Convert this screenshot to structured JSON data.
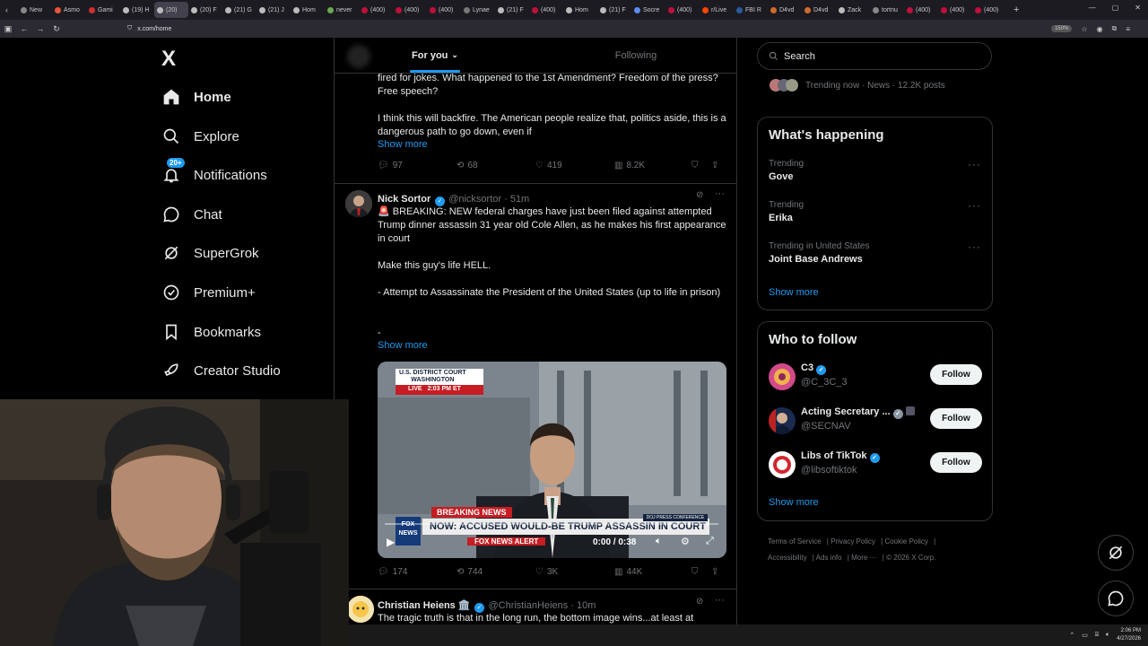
{
  "browser": {
    "tabs": [
      "New",
      "Asmo",
      "Gami",
      "(19) H",
      "(20)",
      "(20) F",
      "(21) G",
      "(21) J",
      "Hom",
      "never",
      "(400)",
      "(400)",
      "(400)",
      "Lynae",
      "(21) F",
      "(400)",
      "Hom",
      "(21) F",
      "Socre",
      "(400)",
      "r/Live",
      "FBI R",
      "D4vd",
      "D4vd",
      "Zack",
      "tortnu",
      "(400)",
      "(400)",
      "(400)"
    ],
    "url": "x.com/home",
    "zoom": "150%"
  },
  "sidebar": {
    "logo": "X",
    "notifications_badge": "20+",
    "items": [
      {
        "label": "Home",
        "icon": "home-icon"
      },
      {
        "label": "Explore",
        "icon": "search-icon"
      },
      {
        "label": "Notifications",
        "icon": "bell-icon"
      },
      {
        "label": "Chat",
        "icon": "chat-icon"
      },
      {
        "label": "SuperGrok",
        "icon": "grok-icon"
      },
      {
        "label": "Premium+",
        "icon": "premium-icon"
      },
      {
        "label": "Bookmarks",
        "icon": "bookmark-icon"
      },
      {
        "label": "Creator Studio",
        "icon": "rocket-icon"
      }
    ]
  },
  "feed": {
    "tabs": {
      "for_you": "For you",
      "following": "Following"
    },
    "post1": {
      "text1": "fired for jokes. What happened to the 1st Amendment? Freedom of the press? Free speech?",
      "text2": "I think this will backfire. The American people realize that, politics aside, this is a dangerous path to go down, even if",
      "show_more": "Show more",
      "replies": "97",
      "reposts": "68",
      "likes": "419",
      "views": "8.2K"
    },
    "post2": {
      "name": "Nick Sortor",
      "handle": "@nicksortor · 51m",
      "line1": "🚨 BREAKING: NEW federal charges have just been filed against attempted Trump dinner assassin 31 year old Cole Allen, as he makes his first appearance in court",
      "line2": "Make this guy's life HELL.",
      "line3": "- Attempt to Assassinate the President of the United States (up to life in prison)",
      "line4": "-",
      "show_more": "Show more",
      "video": {
        "court_label": "U.S. DISTRICT COURT",
        "court_city": "WASHINGTON",
        "live": "LIVE",
        "time": "2:03 PM ET",
        "breaking": "BREAKING NEWS",
        "headline": "NOW: ACCUSED WOULD-BE TRUMP ASSASSIN IN COURT",
        "network": "FOX NEWS",
        "alert": "FOX NEWS ALERT",
        "sub_label": "DOJ PRESS CONFERENCE",
        "timecode": "0:00 / 0:38"
      },
      "replies": "174",
      "reposts": "744",
      "likes": "3K",
      "views": "44K"
    },
    "post3": {
      "name": "Christian Heiens 🏛️",
      "handle": "@ChristianHeiens · 10m",
      "text": "The tragic truth is that in the long run, the bottom image wins...at least at"
    }
  },
  "right": {
    "search_placeholder": "Search",
    "trending_now": "Trending now · News · 12.2K posts",
    "whats_happening": "What's happening",
    "trends": [
      {
        "meta": "Trending",
        "name": "Gove"
      },
      {
        "meta": "Trending",
        "name": "Erika"
      },
      {
        "meta": "Trending in United States",
        "name": "Joint Base Andrews"
      }
    ],
    "show_more": "Show more",
    "who_to_follow": "Who to follow",
    "follow_label": "Follow",
    "accounts": [
      {
        "name": "C3",
        "handle": "@C_3C_3"
      },
      {
        "name": "Acting Secretary ...",
        "handle": "@SECNAV"
      },
      {
        "name": "Libs of TikTok",
        "handle": "@libsoftiktok"
      }
    ],
    "footer": [
      "Terms of Service",
      "Privacy Policy",
      "Cookie Policy",
      "Accessibility",
      "Ads info",
      "More ···",
      "© 2026 X Corp."
    ]
  },
  "taskbar": {
    "time": "2:06 PM",
    "date": "4/27/2026"
  }
}
